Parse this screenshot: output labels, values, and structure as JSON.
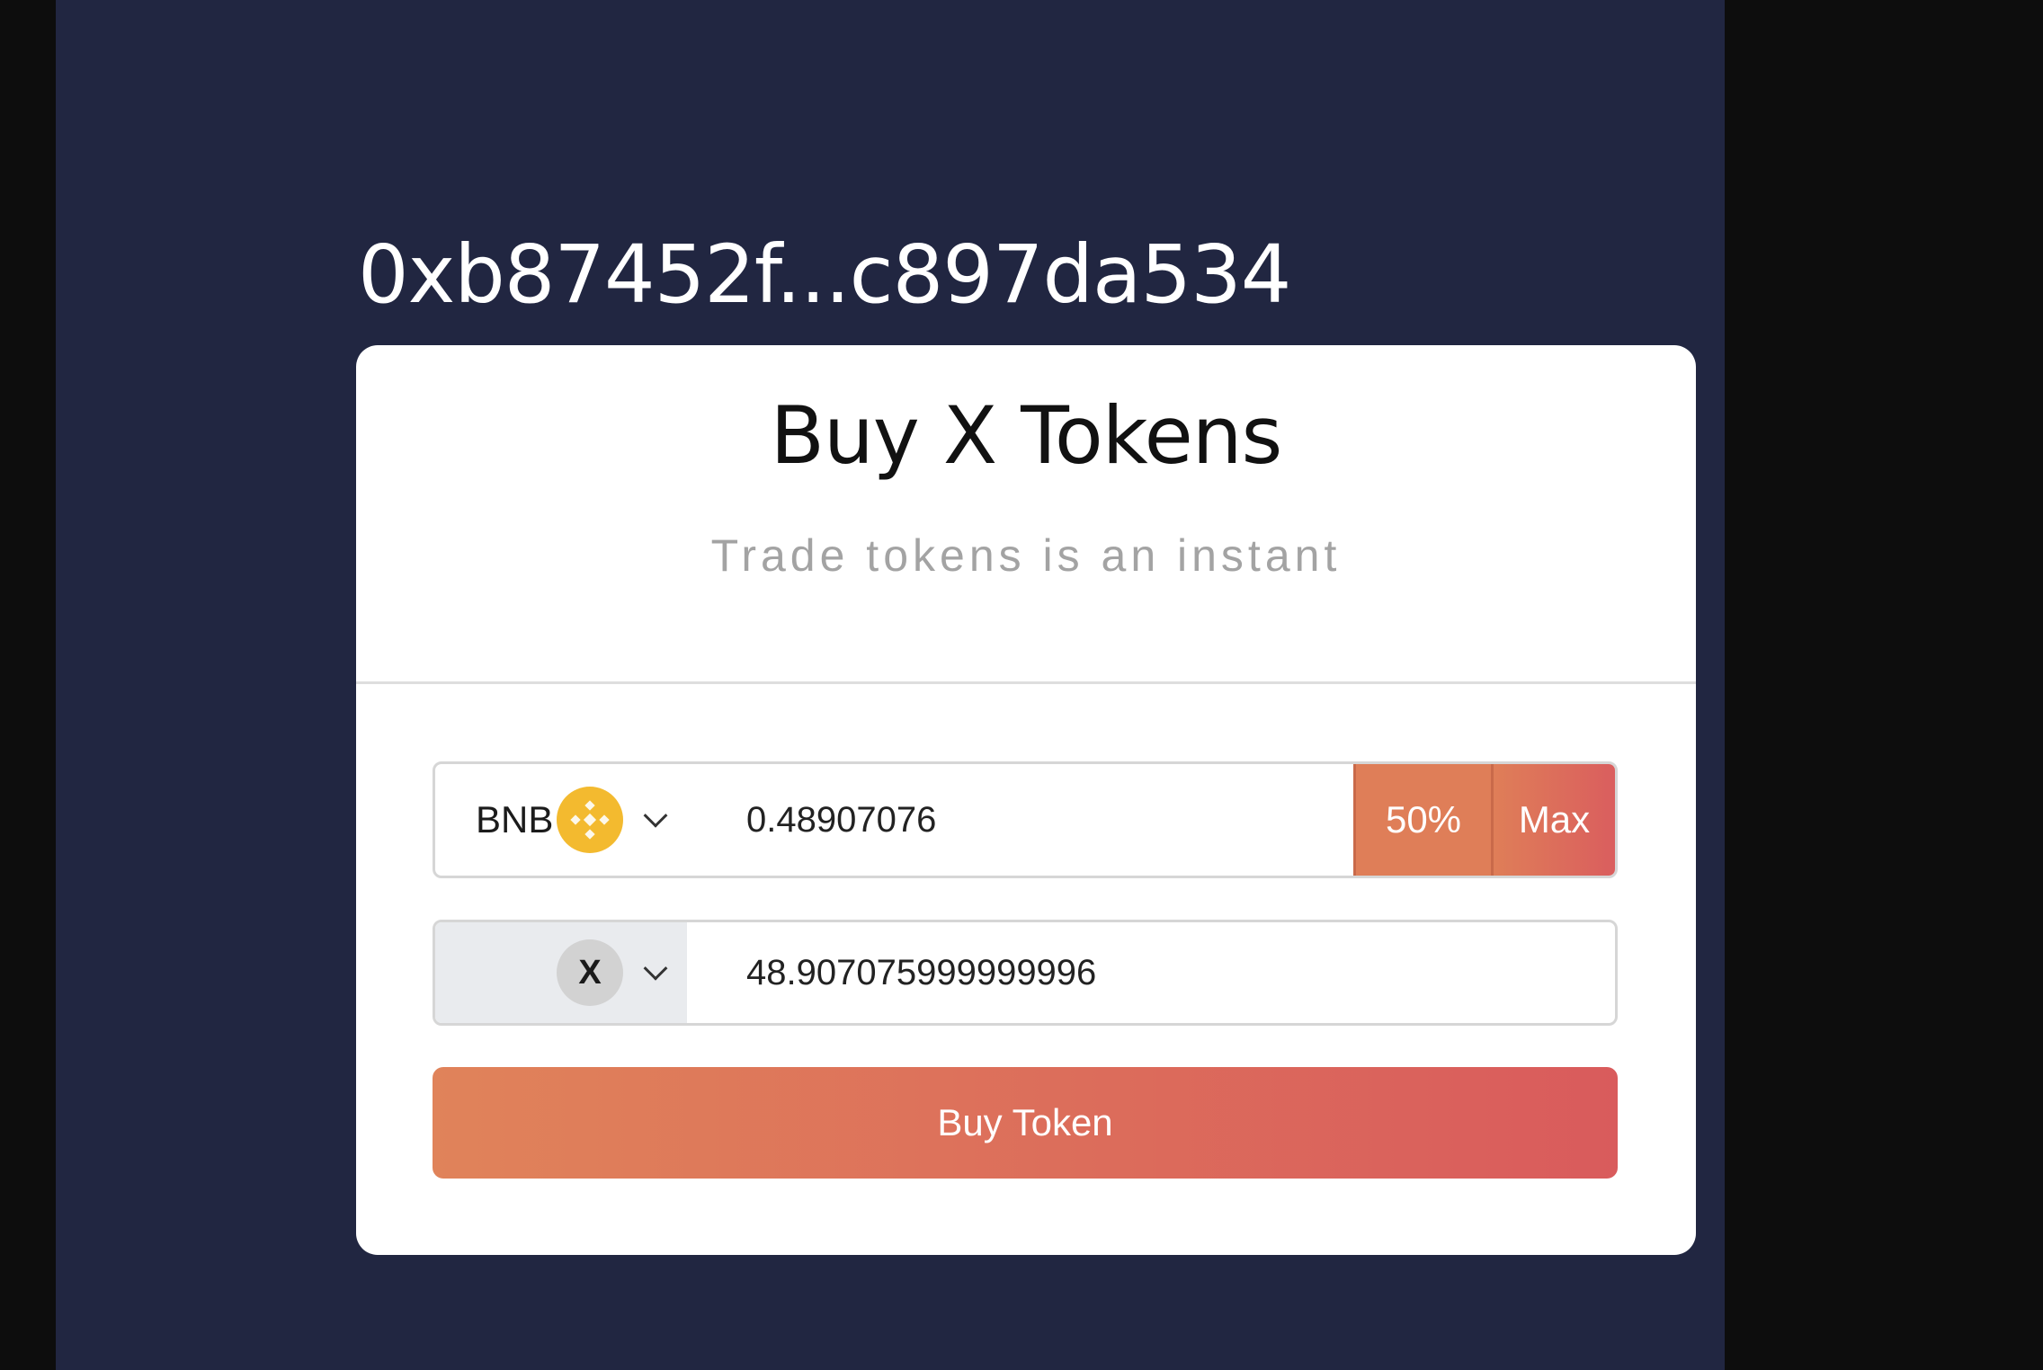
{
  "wallet": {
    "address": "0xb87452f...c897da534"
  },
  "card": {
    "title": "Buy X Tokens",
    "subtitle": "Trade tokens is an instant"
  },
  "pay": {
    "symbol": "BNB",
    "icon": "bnb-coin-icon",
    "amount": "0.48907076",
    "half_label": "50%",
    "max_label": "Max"
  },
  "receive": {
    "symbol": "",
    "icon_text": "X",
    "amount": "48.907075999999996"
  },
  "buy_button": {
    "label": "Buy Token"
  },
  "colors": {
    "background": "#212641",
    "accent_start": "#e0835a",
    "accent_end": "#d95b5c",
    "bnb": "#f3ba2f"
  }
}
